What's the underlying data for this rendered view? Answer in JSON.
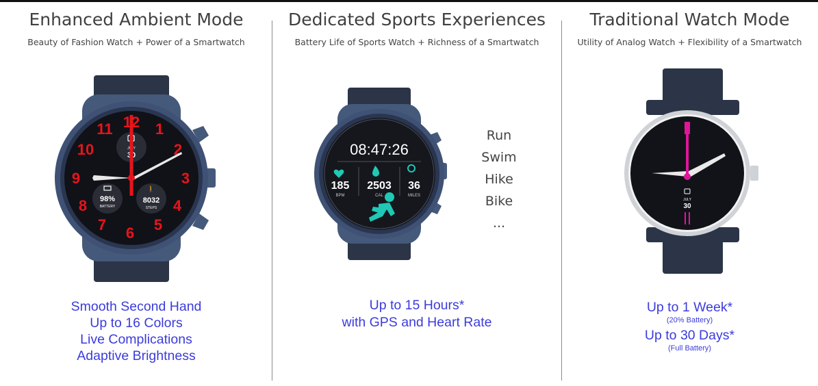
{
  "colors": {
    "accent_blue": "#3b3bdc",
    "strap": "#2b3547",
    "case_blue": "#45597a",
    "red": "#e8141c",
    "teal": "#1fc9b5",
    "magenta": "#e0169a",
    "silver": "#cfd2d6"
  },
  "columns": [
    {
      "title": "Enhanced Ambient Mode",
      "subtitle": "Beauty of Fashion Watch + Power of a Smartwatch",
      "features": [
        "Smooth Second Hand",
        "Up to 16 Colors",
        "Live Complications",
        "Adaptive Brightness"
      ],
      "watch": {
        "numerals": [
          "12",
          "1",
          "2",
          "3",
          "4",
          "5",
          "6",
          "7",
          "8",
          "9",
          "10",
          "11"
        ],
        "date_month": "JULY",
        "date_day": "30",
        "battery_value": "98%",
        "battery_label": "BATTERY",
        "steps_value": "8032",
        "steps_label": "STEPS"
      }
    },
    {
      "title": "Dedicated Sports Experiences",
      "subtitle": "Battery Life of Sports Watch + Richness of a Smartwatch",
      "features": [
        "Up to 15 Hours*",
        "with GPS and Heart Rate"
      ],
      "activities": [
        "Run",
        "Swim",
        "Hike",
        "Bike",
        "..."
      ],
      "watch": {
        "time": "08:47:26",
        "stats": [
          {
            "value": "185",
            "label": "BPM",
            "icon": "heart-rate-icon"
          },
          {
            "value": "2503",
            "label": "CAL",
            "icon": "flame-icon"
          },
          {
            "value": "36",
            "label": "MILES",
            "icon": "location-pin-icon"
          }
        ]
      }
    },
    {
      "title": "Traditional Watch Mode",
      "subtitle": "Utility of Analog Watch + Flexibility of a Smartwatch",
      "features": [
        {
          "main": "Up to 1 Week*",
          "note": "(20% Battery)"
        },
        {
          "main": "Up to 30 Days*",
          "note": "(Full Battery)"
        }
      ],
      "watch": {
        "date_month": "JULY",
        "date_day": "30"
      }
    }
  ]
}
